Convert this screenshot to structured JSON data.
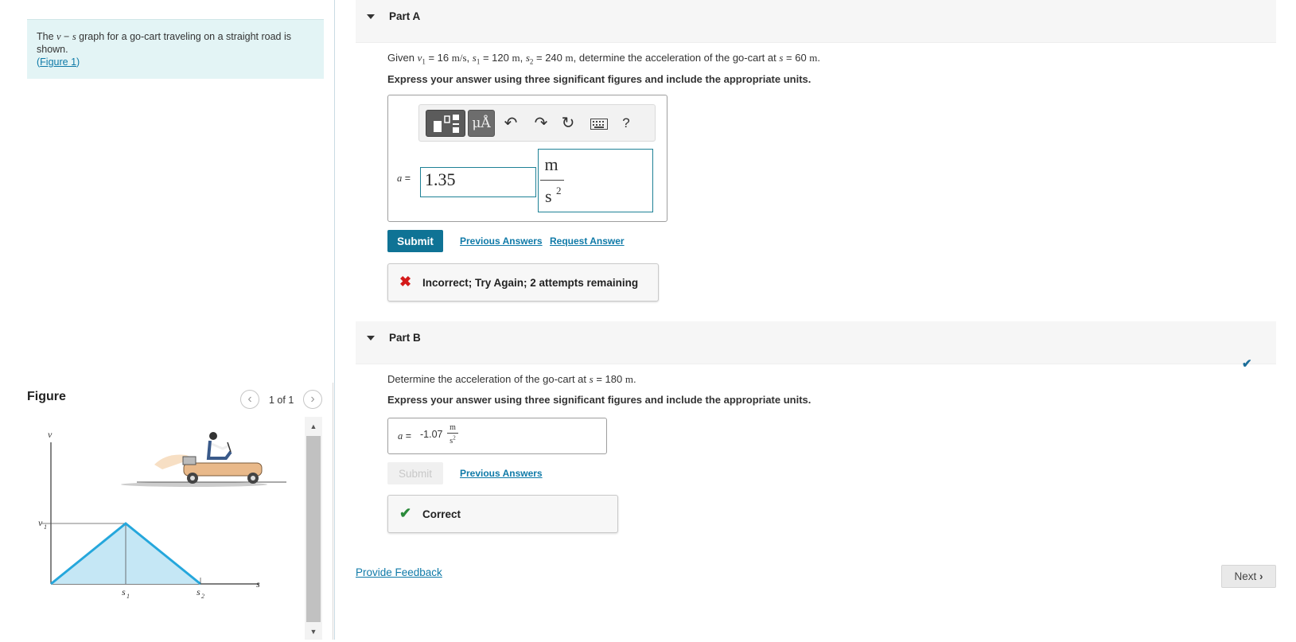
{
  "intro": {
    "text_pre": "The ",
    "var_v": "v",
    "dash": " − ",
    "var_s": "s",
    "text_post": " graph for a go-cart traveling on a straight road is shown.",
    "figure_link": "Figure 1",
    "paren_open": "(",
    "paren_close": ")"
  },
  "figure": {
    "title": "Figure",
    "count": "1 of 1",
    "prev_icon": "chevron-left-icon",
    "next_icon": "chevron-right-icon",
    "labels": {
      "v_axis": "v",
      "s_axis": "s",
      "v1": "v",
      "v1_sub": "1",
      "s1": "s",
      "s1_sub": "1",
      "s2": "s",
      "s2_sub": "2"
    }
  },
  "partA": {
    "title": "Part A",
    "question": {
      "given": "Given ",
      "v1": "v",
      "v1_sub": "1",
      "v1_val": " = 16 ",
      "v1_unit": "m/s",
      "sep1": ", ",
      "s1": "s",
      "s1_sub": "1",
      "s1_val": " = 120 ",
      "s1_unit": "m",
      "sep2": ", ",
      "s2": "s",
      "s2_sub": "2",
      "s2_val": " = 240 ",
      "s2_unit": "m",
      "rest": ", determine the acceleration of the go-cart at ",
      "s": "s",
      "s_val": " = 60 ",
      "s_unit": "m",
      "end": "."
    },
    "instruction": "Express your answer using three significant figures and include the appropriate units.",
    "toolbar": {
      "units_label": "μÅ",
      "help_label": "?"
    },
    "answer_label": "a =",
    "answer_var": "a",
    "answer_eq": " =",
    "answer_value": "1.35",
    "unit_num": "m",
    "unit_den": "s",
    "unit_den_exp": "2",
    "submit_label": "Submit",
    "previous_answers": "Previous Answers",
    "request_answer": "Request Answer",
    "feedback": "Incorrect; Try Again; 2 attempts remaining"
  },
  "partB": {
    "title": "Part B",
    "question": {
      "pre": "Determine the acceleration of the go-cart at ",
      "s": "s",
      "s_val": " = 180 ",
      "s_unit": "m",
      "end": "."
    },
    "instruction": "Express your answer using three significant figures and include the appropriate units.",
    "answer_var": "a",
    "answer_eq": " =",
    "answer_value": "-1.07",
    "unit_num": "m",
    "unit_den": "s",
    "unit_den_exp": "2",
    "submit_label": "Submit",
    "previous_answers": "Previous Answers",
    "feedback": "Correct"
  },
  "footer": {
    "provide_feedback": "Provide Feedback",
    "next_label": "Next"
  },
  "colors": {
    "accent": "#0f7395",
    "link": "#0f7aa8",
    "intro_bg": "#e3f4f5",
    "incorrect": "#d41a1a",
    "correct": "#2a8a3a",
    "graph_line": "#25a7dc",
    "graph_fill": "#c5e7f5"
  }
}
